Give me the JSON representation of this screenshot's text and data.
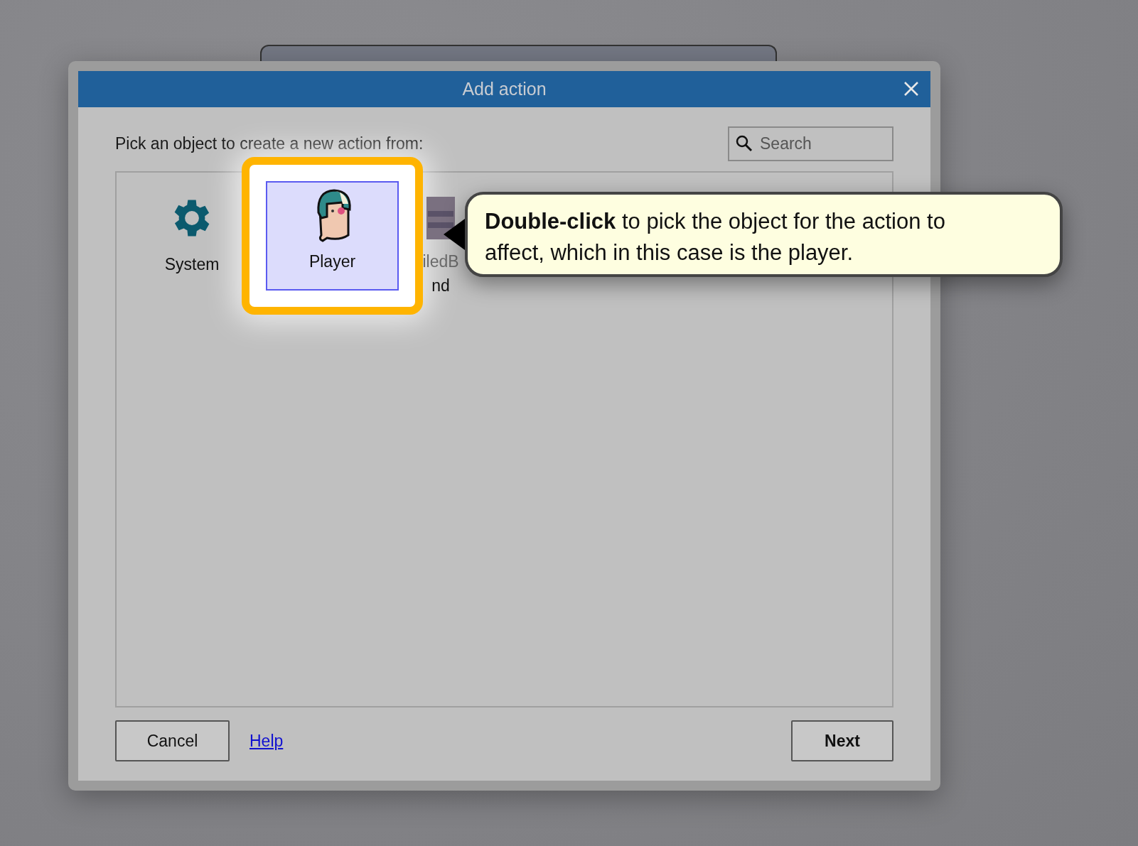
{
  "window": {
    "title": "Add action"
  },
  "instruction": "Pick an object to create a new action from:",
  "search": {
    "placeholder": "Search"
  },
  "objects": [
    {
      "kind": "system",
      "lines": [
        "System"
      ],
      "selected": false
    },
    {
      "kind": "player",
      "lines": [
        "Player"
      ],
      "selected": true
    },
    {
      "kind": "tiled",
      "lines": [
        "iledB",
        "nd"
      ],
      "selected": false
    }
  ],
  "callout": "**Double-click** to pick the object for the action to affect, which in this case is the player.",
  "buttons": {
    "cancel": "Cancel",
    "help": "Help",
    "next": "Next"
  }
}
